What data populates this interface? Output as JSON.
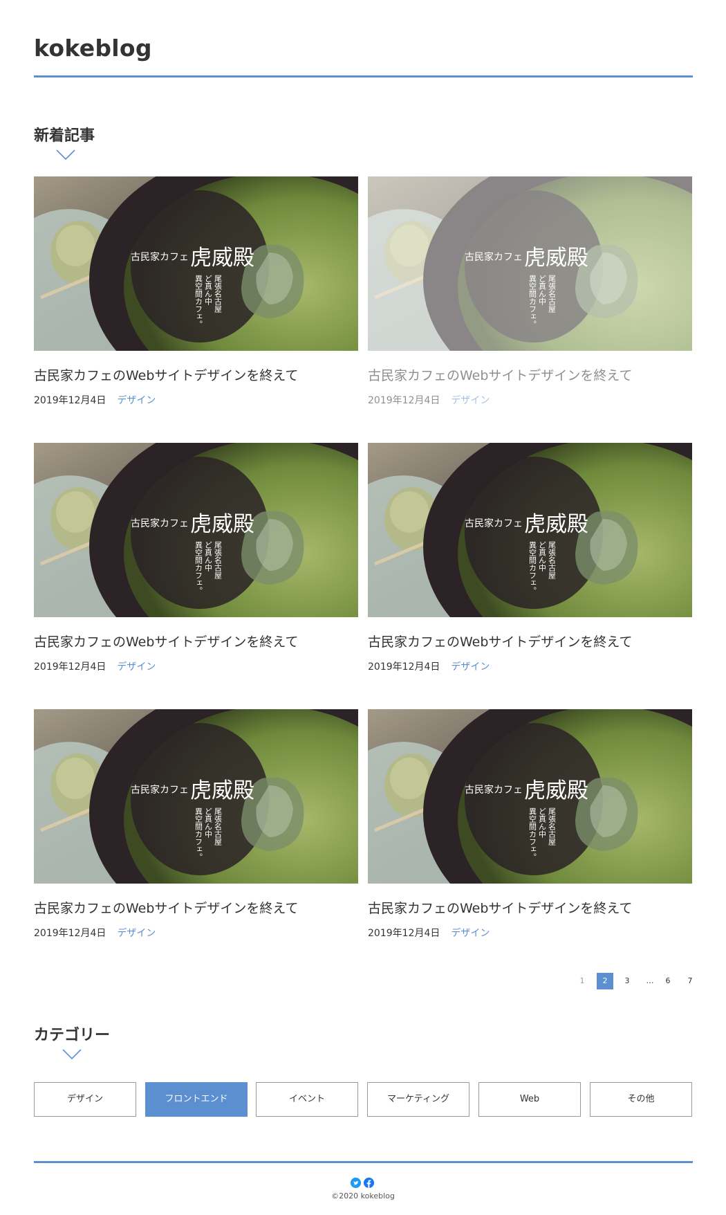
{
  "header": {
    "site_title": "kokeblog"
  },
  "latest": {
    "heading": "新着記事",
    "posts": [
      {
        "image_title": "虎威殿",
        "image_prefix": "古民家カフェ",
        "image_tagline": [
          "尾張名古屋",
          "ど真ん中",
          "異空間カフェ。"
        ],
        "title": "古民家カフェのWebサイトデザインを終えて",
        "date": "2019年12月4日",
        "category": "デザイン"
      },
      {
        "image_title": "虎威殿",
        "image_prefix": "古民家カフェ",
        "image_tagline": [
          "尾張名古屋",
          "ど真ん中",
          "異空間カフェ。"
        ],
        "title": "古民家カフェのWebサイトデザインを終えて",
        "date": "2019年12月4日",
        "category": "デザイン"
      },
      {
        "image_title": "虎威殿",
        "image_prefix": "古民家カフェ",
        "image_tagline": [
          "尾張名古屋",
          "ど真ん中",
          "異空間カフェ。"
        ],
        "title": "古民家カフェのWebサイトデザインを終えて",
        "date": "2019年12月4日",
        "category": "デザイン"
      },
      {
        "image_title": "虎威殿",
        "image_prefix": "古民家カフェ",
        "image_tagline": [
          "尾張名古屋",
          "ど真ん中",
          "異空間カフェ。"
        ],
        "title": "古民家カフェのWebサイトデザインを終えて",
        "date": "2019年12月4日",
        "category": "デザイン"
      },
      {
        "image_title": "虎威殿",
        "image_prefix": "古民家カフェ",
        "image_tagline": [
          "尾張名古屋",
          "ど真ん中",
          "異空間カフェ。"
        ],
        "title": "古民家カフェのWebサイトデザインを終えて",
        "date": "2019年12月4日",
        "category": "デザイン"
      },
      {
        "image_title": "虎威殿",
        "image_prefix": "古民家カフェ",
        "image_tagline": [
          "尾張名古屋",
          "ど真ん中",
          "異空間カフェ。"
        ],
        "title": "古民家カフェのWebサイトデザインを終えて",
        "date": "2019年12月4日",
        "category": "デザイン"
      }
    ]
  },
  "pagination": {
    "pages": [
      "1",
      "2",
      "3",
      "…",
      "6",
      "7"
    ],
    "current": "2"
  },
  "categories": {
    "heading": "カテゴリー",
    "items": [
      "デザイン",
      "フロントエンド",
      "イベント",
      "マーケティング",
      "Web",
      "その他"
    ],
    "active": "フロントエンド"
  },
  "footer": {
    "icons": [
      "twitter-icon",
      "facebook-icon"
    ],
    "copyright": "©2020 kokeblog"
  },
  "colors": {
    "accent": "#5b8fd0",
    "text": "#333333"
  }
}
